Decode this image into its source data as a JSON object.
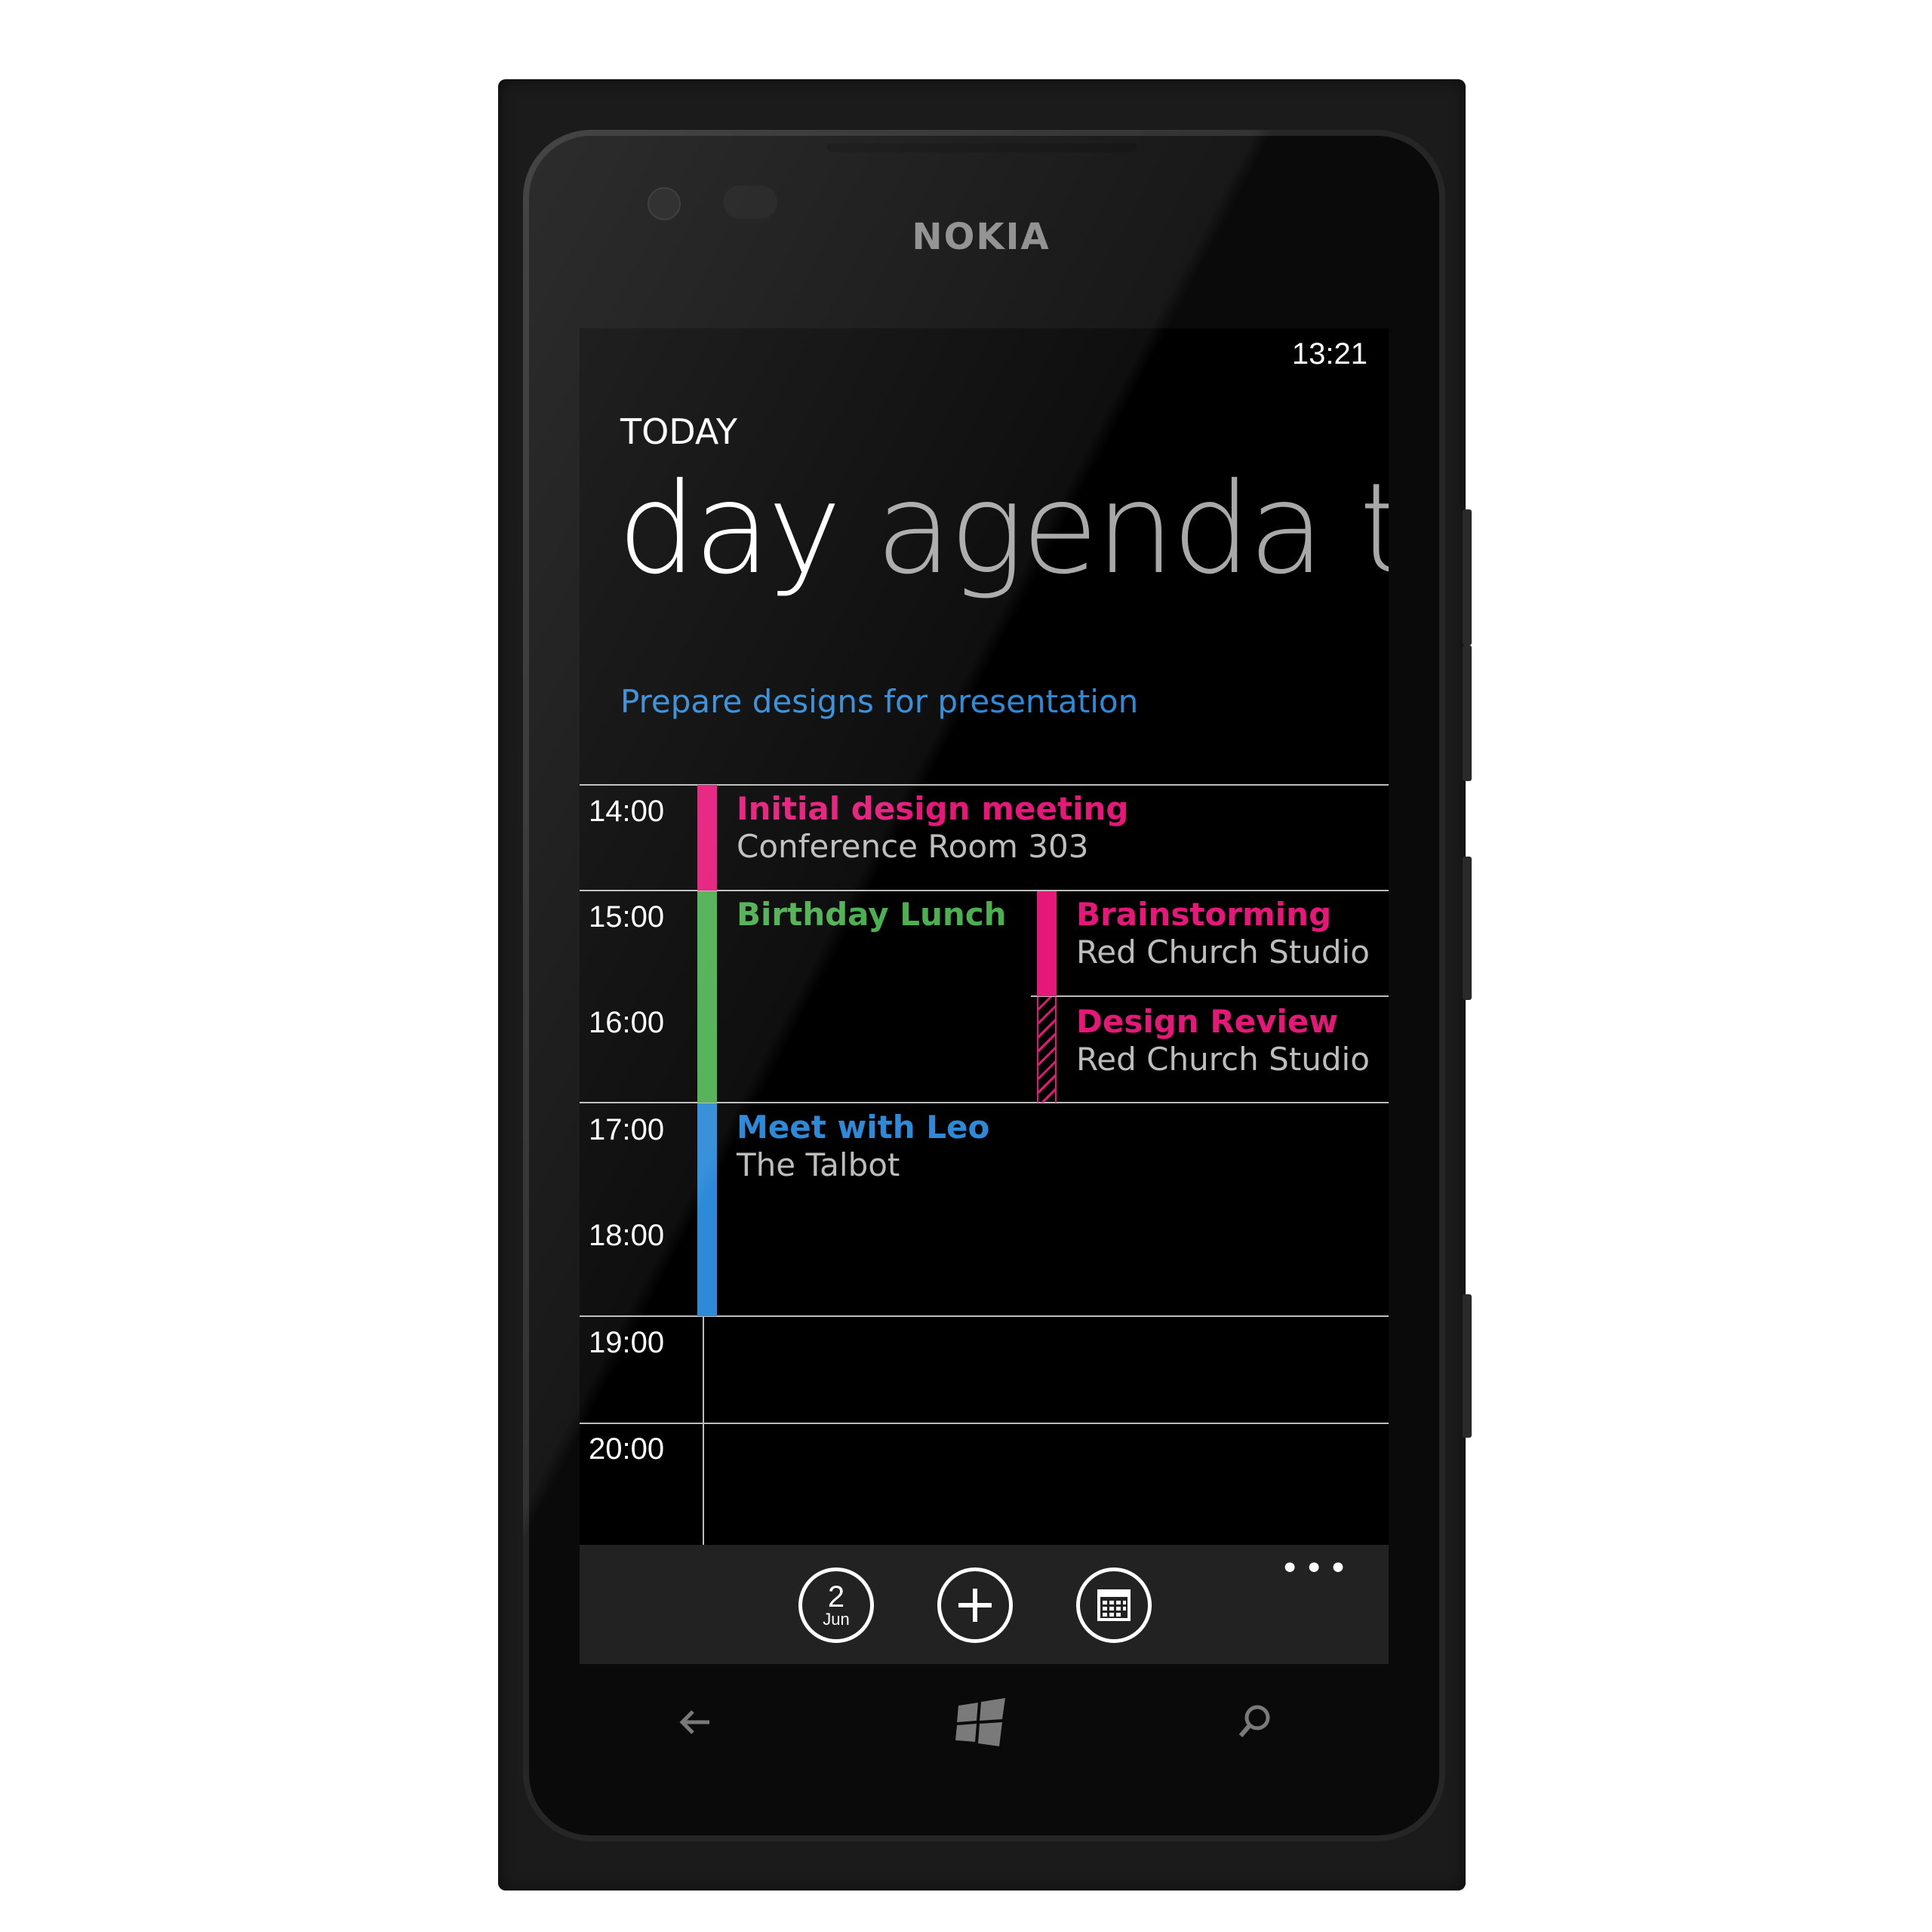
{
  "device": {
    "brand": "NOKIA"
  },
  "status": {
    "time": "13:21"
  },
  "header": {
    "section": "TODAY",
    "pivot_active": "day",
    "pivot_next": "agenda",
    "pivot_peek": "to-"
  },
  "task": {
    "label": "Prepare designs for presentation"
  },
  "hours": [
    "14:00",
    "15:00",
    "16:00",
    "17:00",
    "18:00",
    "19:00",
    "20:00"
  ],
  "events": [
    {
      "title": "Initial design meeting",
      "location": "Conference Room 303",
      "color": "#e5187a"
    },
    {
      "title": "Birthday Lunch",
      "location": "",
      "color": "#4caf50"
    },
    {
      "title": "Brainstorming",
      "location": "Red Church Studio",
      "color": "#e5187a"
    },
    {
      "title": "Design Review",
      "location": "Red Church Studio",
      "color": "#e5187a",
      "tentative": true
    },
    {
      "title": "Meet with Leo",
      "location": "The Talbot",
      "color": "#2d8ad8"
    }
  ],
  "appbar": {
    "today_day": "2",
    "today_month": "Jun",
    "new_icon": "plus-icon",
    "month_icon": "calendar-grid-icon",
    "more_label": "•••"
  },
  "colors": {
    "accent": "#2d8ad8",
    "pink": "#e5187a",
    "green": "#4caf50",
    "blue": "#2d8ad8"
  }
}
